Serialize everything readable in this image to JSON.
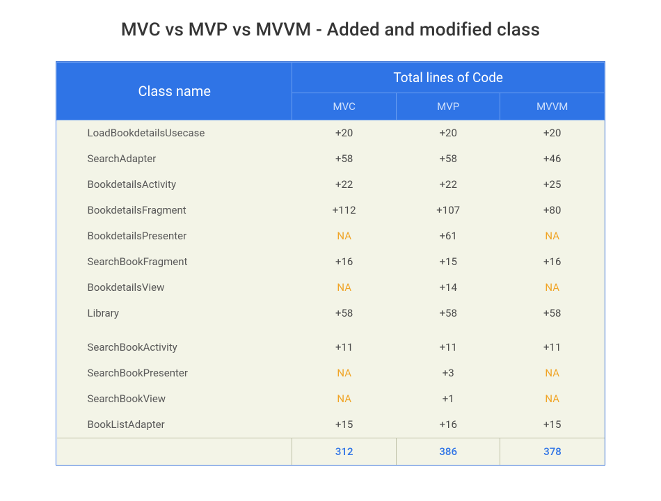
{
  "title": "MVC vs MVP vs MVVM - Added and modified class",
  "header": {
    "classname": "Class name",
    "total": "Total lines of Code",
    "cols": [
      "MVC",
      "MVP",
      "MVVM"
    ]
  },
  "rows": [
    {
      "name": "LoadBookdetailsUsecase",
      "mvc": "+20",
      "mvp": "+20",
      "mvvm": "+20"
    },
    {
      "name": "SearchAdapter",
      "mvc": "+58",
      "mvp": "+58",
      "mvvm": "+46"
    },
    {
      "name": "BookdetailsActivity",
      "mvc": "+22",
      "mvp": "+22",
      "mvvm": "+25"
    },
    {
      "name": "BookdetailsFragment",
      "mvc": "+112",
      "mvp": "+107",
      "mvvm": "+80"
    },
    {
      "name": "BookdetailsPresenter",
      "mvc": "NA",
      "mvp": "+61",
      "mvvm": "NA"
    },
    {
      "name": "SearchBookFragment",
      "mvc": "+16",
      "mvp": "+15",
      "mvvm": "+16"
    },
    {
      "name": "BookdetailsView",
      "mvc": "NA",
      "mvp": "+14",
      "mvvm": "NA"
    },
    {
      "name": "Library",
      "mvc": "+58",
      "mvp": "+58",
      "mvvm": "+58"
    },
    {
      "name": "SearchBookActivity",
      "mvc": "+11",
      "mvp": "+11",
      "mvvm": "+11"
    },
    {
      "name": "SearchBookPresenter",
      "mvc": "NA",
      "mvp": "+3",
      "mvvm": "NA"
    },
    {
      "name": "SearchBookView",
      "mvc": "NA",
      "mvp": "+1",
      "mvvm": "NA"
    },
    {
      "name": "BookListAdapter",
      "mvc": "+15",
      "mvp": "+16",
      "mvvm": "+15"
    }
  ],
  "totals": {
    "mvc": "312",
    "mvp": "386",
    "mvvm": "378"
  },
  "na_text": "NA",
  "chart_data": {
    "type": "table",
    "title": "MVC vs MVP vs MVVM - Added and modified class",
    "columns": [
      "Class name",
      "MVC",
      "MVP",
      "MVVM"
    ],
    "series": [
      {
        "name": "MVC",
        "values": [
          20,
          58,
          22,
          112,
          null,
          16,
          null,
          58,
          11,
          null,
          null,
          15
        ],
        "total": 312
      },
      {
        "name": "MVP",
        "values": [
          20,
          58,
          22,
          107,
          61,
          15,
          14,
          58,
          11,
          3,
          1,
          16
        ],
        "total": 386
      },
      {
        "name": "MVVM",
        "values": [
          20,
          46,
          25,
          80,
          null,
          16,
          null,
          58,
          11,
          null,
          null,
          15
        ],
        "total": 378
      }
    ],
    "categories": [
      "LoadBookdetailsUsecase",
      "SearchAdapter",
      "BookdetailsActivity",
      "BookdetailsFragment",
      "BookdetailsPresenter",
      "SearchBookFragment",
      "BookdetailsView",
      "Library",
      "SearchBookActivity",
      "SearchBookPresenter",
      "SearchBookView",
      "BookListAdapter"
    ]
  }
}
